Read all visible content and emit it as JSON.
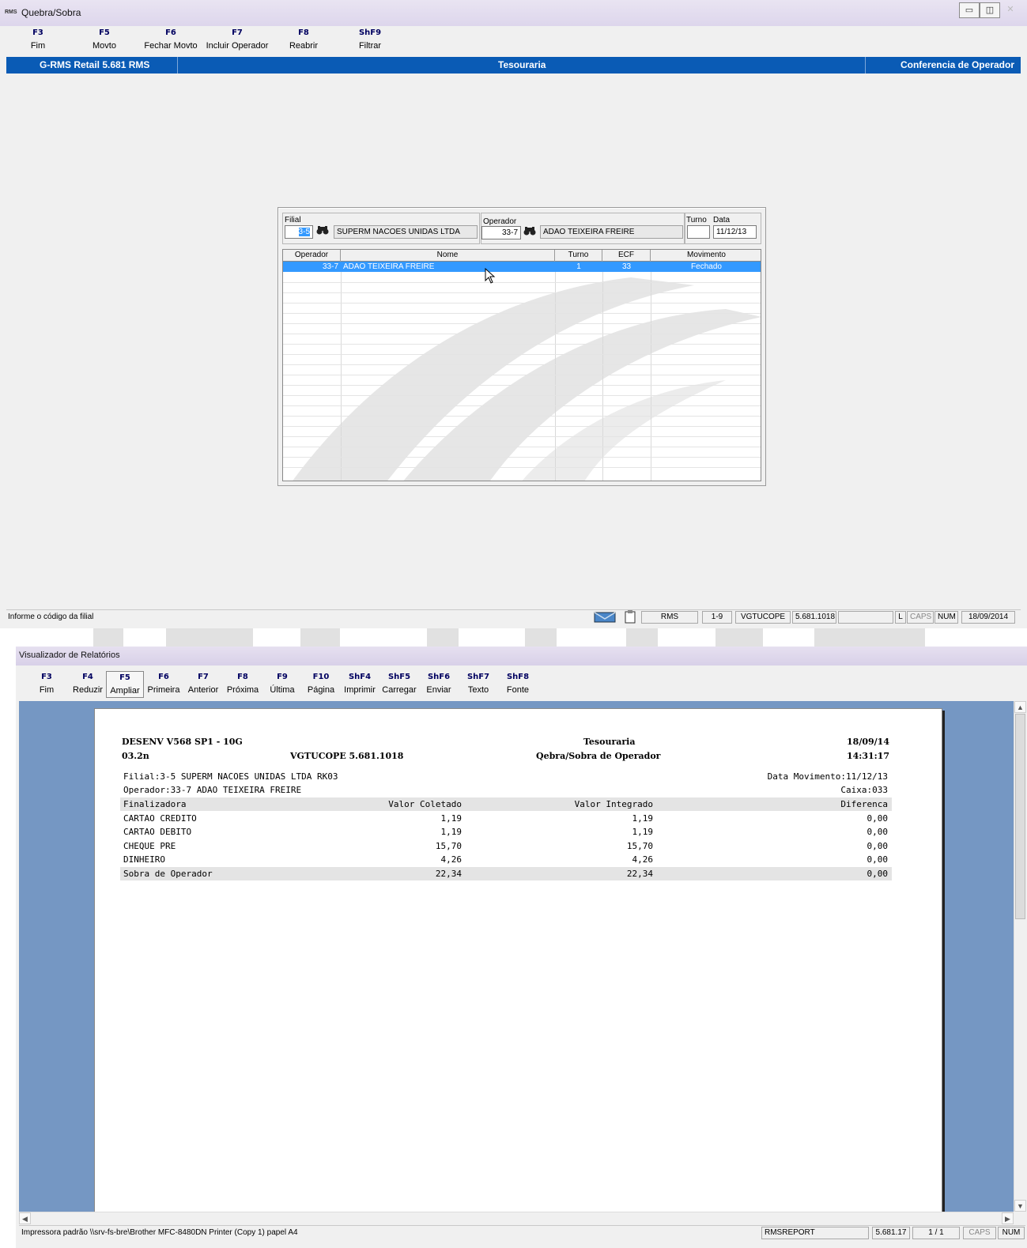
{
  "window1": {
    "logo": "RMS",
    "title": "Quebra/Sobra",
    "controls": {
      "minimize": "▭",
      "maximize": "◫",
      "close": "✕"
    },
    "fkeys": [
      {
        "key": "F3",
        "label": "Fim"
      },
      {
        "key": "F5",
        "label": "Movto"
      },
      {
        "key": "F6",
        "label": "Fechar Movto"
      },
      {
        "key": "F7",
        "label": "Incluir Operador"
      },
      {
        "key": "F8",
        "label": "Reabrir"
      },
      {
        "key": "ShF9",
        "label": "Filtrar"
      }
    ],
    "header": {
      "product": "G-RMS Retail 5.681 RMS",
      "module": "Tesouraria",
      "screen": "Conferencia de Operador"
    },
    "form": {
      "filial_label": "Filial",
      "filial_value": "3-5",
      "filial_name": "SUPERM NACOES UNIDAS LTDA",
      "operador_label": "Operador",
      "operador_value": "33-7",
      "operador_name": "ADAO TEIXEIRA FREIRE",
      "turno_label": "Turno",
      "turno_value": "",
      "data_label": "Data",
      "data_value": "11/12/13"
    },
    "grid": {
      "columns": [
        "Operador",
        "Nome",
        "Turno",
        "ECF",
        "Movimento"
      ],
      "rows": [
        {
          "operador": "33-7",
          "nome": "ADAO TEIXEIRA FREIRE",
          "turno": "1",
          "ecf": "33",
          "movimento": "Fechado"
        }
      ]
    },
    "status": {
      "message": "Informe o código da filial",
      "system": "RMS",
      "range": "1-9",
      "program": "VGTUCOPE",
      "version": "5.681.1018",
      "l": "L",
      "caps": "CAPS",
      "num": "NUM",
      "date": "18/09/2014"
    }
  },
  "window2": {
    "title": "Visualizador de Relatórios",
    "fkeys": [
      {
        "key": "F3",
        "label": "Fim"
      },
      {
        "key": "F4",
        "label": "Reduzir"
      },
      {
        "key": "F5",
        "label": "Ampliar"
      },
      {
        "key": "F6",
        "label": "Primeira"
      },
      {
        "key": "F7",
        "label": "Anterior"
      },
      {
        "key": "F8",
        "label": "Próxima"
      },
      {
        "key": "F9",
        "label": "Última"
      },
      {
        "key": "F10",
        "label": "Página"
      },
      {
        "key": "ShF4",
        "label": "Imprimir"
      },
      {
        "key": "ShF5",
        "label": "Carregar"
      },
      {
        "key": "ShF6",
        "label": "Enviar"
      },
      {
        "key": "ShF7",
        "label": "Texto"
      },
      {
        "key": "ShF8",
        "label": "Fonte"
      }
    ],
    "report": {
      "system": "DESENV V568 SP1 - 10G",
      "build": "03.2n",
      "program": "VGTUCOPE 5.681.1018",
      "module": "Tesouraria",
      "title": "Qebra/Sobra de Operador",
      "date": "18/09/14",
      "time": "14:31:17",
      "filial_line": "Filial:3-5 SUPERM NACOES UNIDAS LTDA RK03",
      "data_movimento": "Data Movimento:11/12/13",
      "operador_line": "Operador:33-7 ADAO TEIXEIRA FREIRE",
      "caixa": "Caixa:033",
      "columns": [
        "Finalizadora",
        "Valor Coletado",
        "Valor Integrado",
        "Diferenca"
      ],
      "rows": [
        {
          "finalizadora": "CARTAO CREDITO",
          "coletado": "1,19",
          "integrado": "1,19",
          "diferenca": "0,00"
        },
        {
          "finalizadora": "CARTAO DEBITO",
          "coletado": "1,19",
          "integrado": "1,19",
          "diferenca": "0,00"
        },
        {
          "finalizadora": "CHEQUE PRE",
          "coletado": "15,70",
          "integrado": "15,70",
          "diferenca": "0,00"
        },
        {
          "finalizadora": "DINHEIRO",
          "coletado": "4,26",
          "integrado": "4,26",
          "diferenca": "0,00"
        }
      ],
      "total": {
        "finalizadora": "Sobra de Operador",
        "coletado": "22,34",
        "integrado": "22,34",
        "diferenca": "0,00"
      }
    },
    "status": {
      "printer": "Impressora padrão \\\\srv-fs-bre\\Brother MFC-8480DN Printer (Copy 1) papel A4",
      "app": "RMSREPORT",
      "version": "5.681.17",
      "pages": "1 / 1",
      "caps": "CAPS",
      "num": "NUM"
    }
  },
  "colors": {
    "header_blue": "#0a5bb5",
    "selection_blue": "#3399ff",
    "viewer_bg": "#7597c3",
    "fkey_text": "#000060"
  }
}
